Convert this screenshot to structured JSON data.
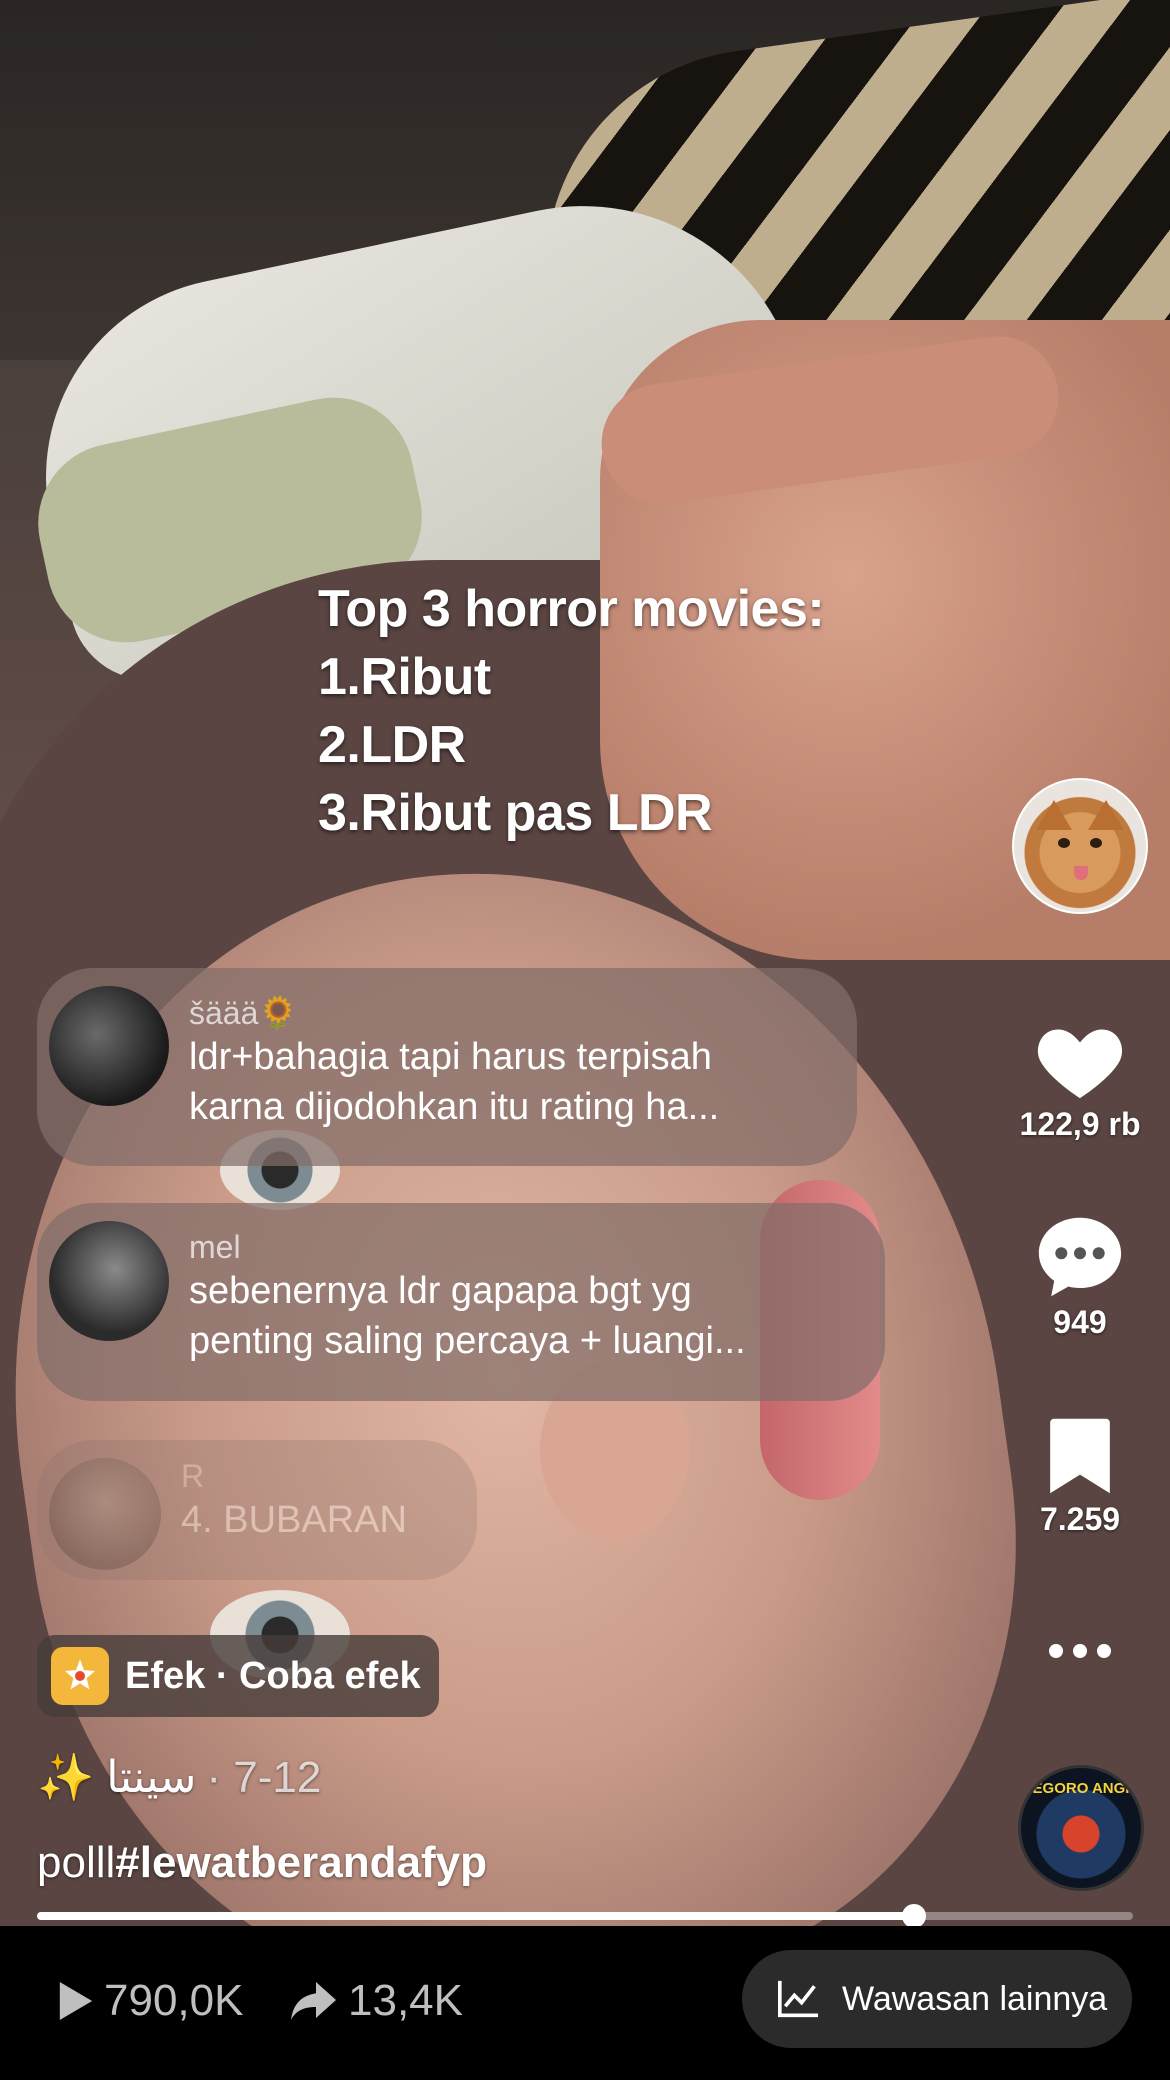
{
  "overlay": {
    "lines": "Top 3 horror movies:\n1.Ribut\n2.LDR\n3.Ribut pas LDR"
  },
  "actions": {
    "likes": "122,9 rb",
    "comments": "949",
    "saves": "7.259",
    "more_icon": "more-dots-icon"
  },
  "comments": [
    {
      "name": "šäää🌻",
      "text_line1": "ldr+bahagia tapi harus terpisah",
      "text_line2": "karna dijodohkan itu rating ha..."
    },
    {
      "name": "mel",
      "text_line1": "sebenernya ldr gapapa bgt yg",
      "text_line2": "penting saling percaya + luangi..."
    },
    {
      "name": "R",
      "text_line1": "4. BUBARAN"
    }
  ],
  "effect": {
    "label": "Efek · Coba efek"
  },
  "author": {
    "sparkle": "✨",
    "name": "سينتا",
    "date": "· 7-12"
  },
  "caption": {
    "prefix": "polll",
    "hashtag": "#lewatberandafyp"
  },
  "music": {
    "disc_text": "NEGORO ANGIN"
  },
  "playback": {
    "progress": 0.8
  },
  "bottom": {
    "plays": "790,0K",
    "shares": "13,4K",
    "insights_label": "Wawasan lainnya"
  }
}
